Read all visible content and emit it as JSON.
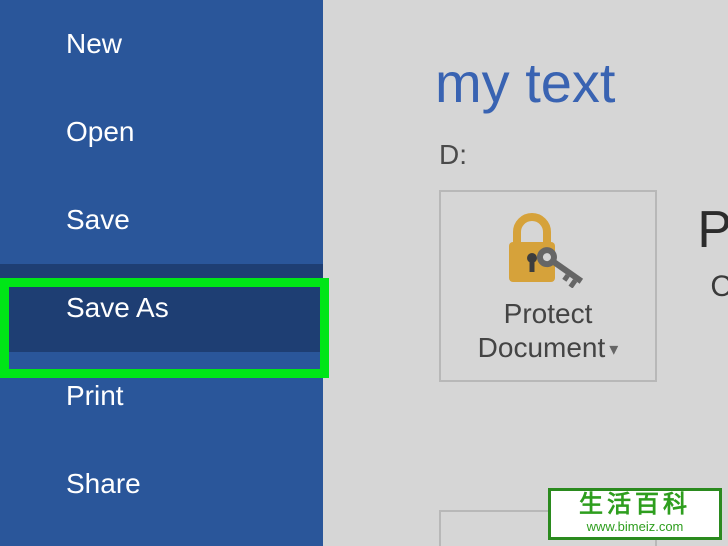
{
  "sidebar": {
    "items": [
      {
        "label": "New"
      },
      {
        "label": "Open"
      },
      {
        "label": "Save"
      },
      {
        "label": "Save As"
      },
      {
        "label": "Print"
      },
      {
        "label": "Share"
      }
    ]
  },
  "content": {
    "title": "my text",
    "location": "D:",
    "protect": {
      "line1": "Protect",
      "line2": "Document"
    },
    "right_partial_1": "P",
    "right_partial_2": "C"
  },
  "watermark": {
    "cn": "生活百科",
    "url": "www.bimeiz.com"
  }
}
